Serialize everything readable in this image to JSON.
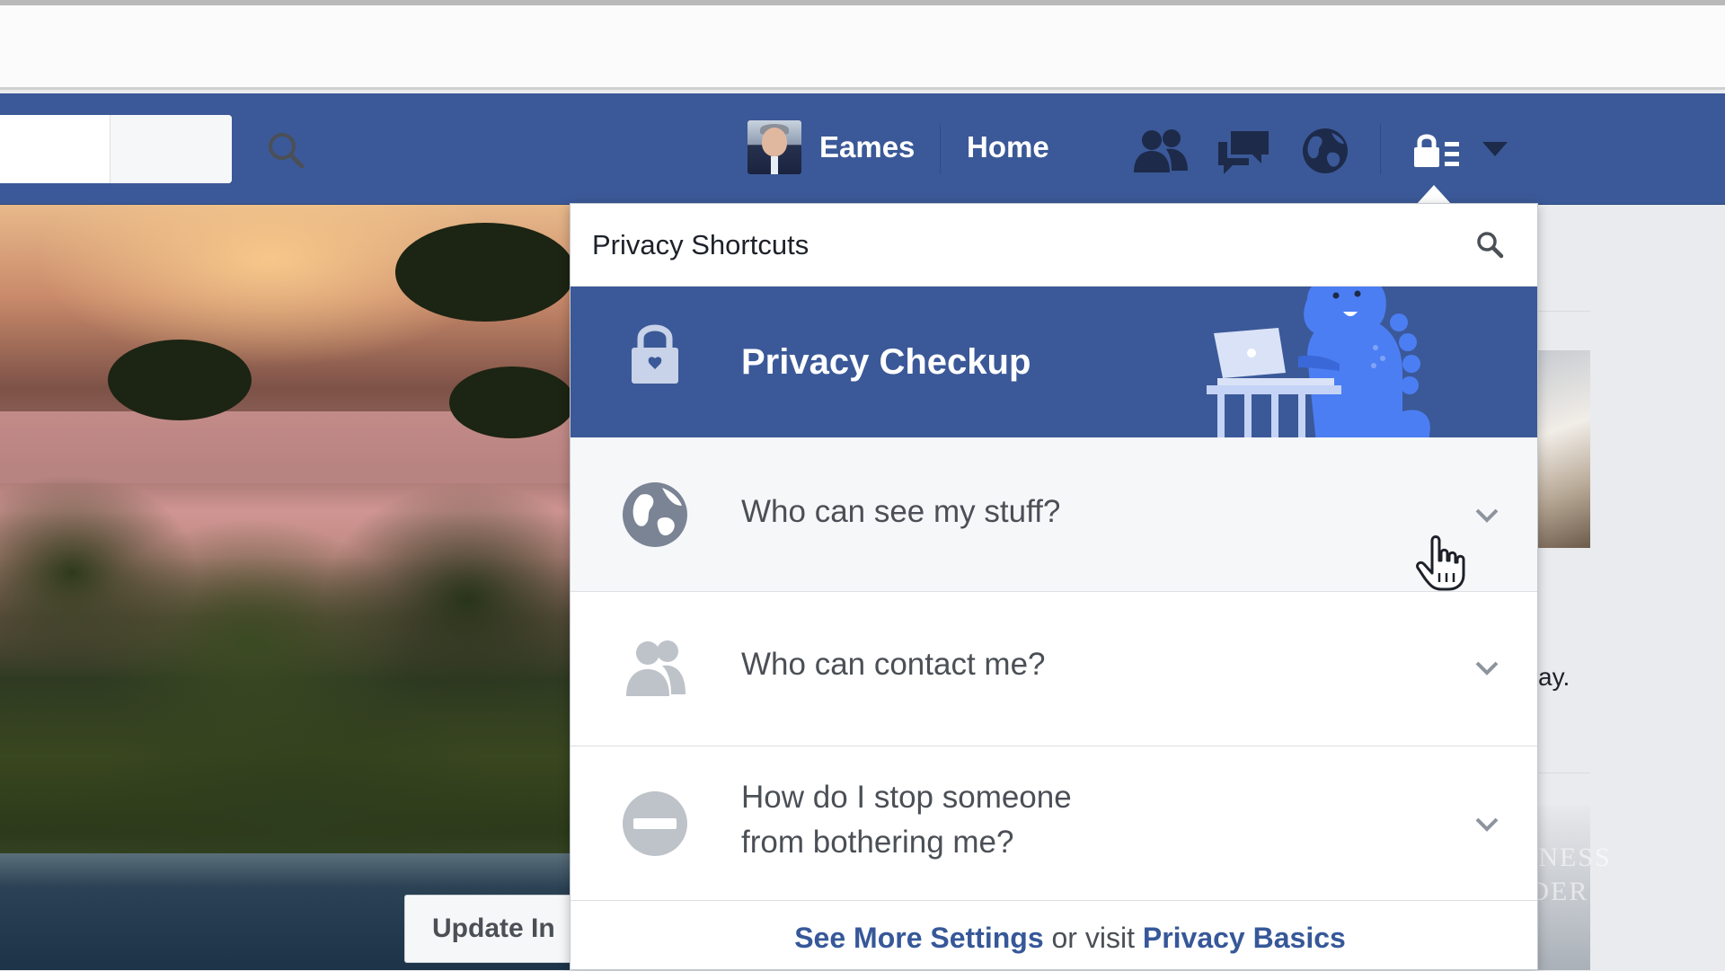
{
  "topnav": {
    "user_name": "Eames",
    "home_label": "Home",
    "icons": [
      "search-icon",
      "friend-requests-icon",
      "messages-icon",
      "notifications-globe-icon",
      "privacy-shortcuts-icon",
      "account-caret-icon"
    ]
  },
  "cover": {
    "update_info_label": "Update In"
  },
  "sidebar_right": {
    "snippet_text": "ay.",
    "watermark": "BUSINESS INSIDER"
  },
  "privacy_menu": {
    "title": "Privacy Shortcuts",
    "checkup": {
      "label": "Privacy Checkup",
      "icon": "lock-icon",
      "illustration": "dinosaur-laptop-mascot"
    },
    "items": [
      {
        "label": "Who can see my stuff?",
        "icon": "globe-icon"
      },
      {
        "label": "Who can contact me?",
        "icon": "people-icon"
      },
      {
        "label_line1": "How do I stop someone",
        "label_line2": "from bothering me?",
        "icon": "block-icon"
      }
    ],
    "footer": {
      "see_more_label": "See More Settings",
      "connector_text": " or visit ",
      "privacy_basics_label": "Privacy Basics"
    }
  },
  "colors": {
    "facebook_blue": "#3b5998",
    "link_blue": "#365899",
    "mascot_blue": "#4c7ef3"
  }
}
